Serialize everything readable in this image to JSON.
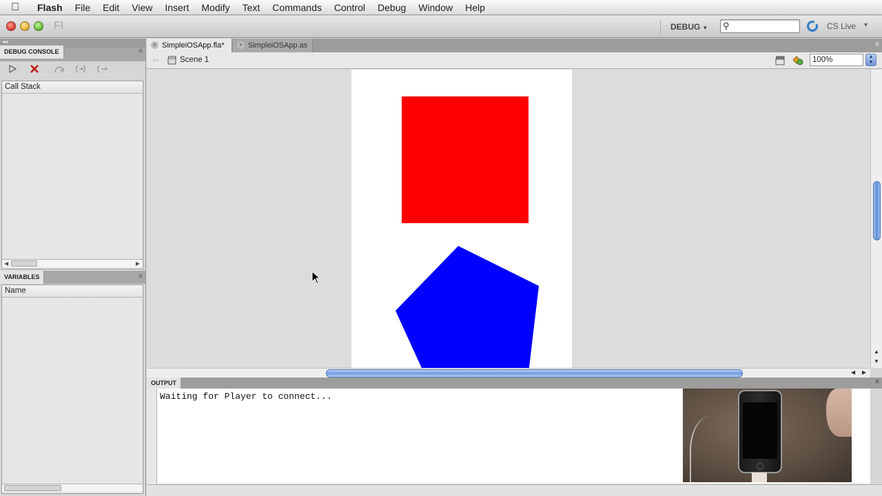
{
  "menubar": {
    "app_name": "Flash",
    "items": [
      "File",
      "Edit",
      "View",
      "Insert",
      "Modify",
      "Text",
      "Commands",
      "Control",
      "Debug",
      "Window",
      "Help"
    ]
  },
  "appbar": {
    "logo": "Fl",
    "workspace": "DEBUG",
    "search_placeholder": "",
    "cs_live": "CS Live"
  },
  "debug_console": {
    "tab": "DEBUG CONSOLE",
    "call_stack_header": "Call Stack"
  },
  "variables": {
    "tab": "VARIABLES",
    "name_header": "Name"
  },
  "document_tabs": [
    {
      "label": "SimpleiOSApp.fla*",
      "active": true
    },
    {
      "label": "SimpleiOSApp.as",
      "active": false
    }
  ],
  "editbar": {
    "scene": "Scene 1",
    "zoom": "100%"
  },
  "stage": {
    "rect_color": "#ff0000",
    "pentagon_color": "#0000ff"
  },
  "output": {
    "tab": "OUTPUT",
    "text": "Waiting for Player to connect..."
  }
}
